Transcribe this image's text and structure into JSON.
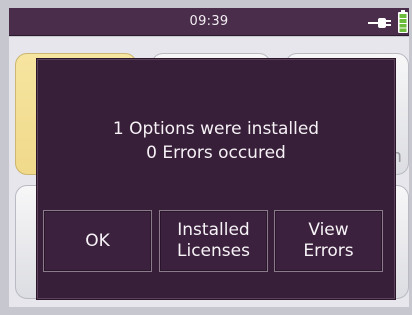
{
  "status_bar": {
    "time": "09:39",
    "icons": [
      "plug-icon",
      "battery-icon"
    ]
  },
  "background": {
    "tile_fragment": "n"
  },
  "dialog": {
    "line1": "1 Options were installed",
    "line2": "0 Errors occured",
    "buttons": {
      "ok": "OK",
      "installed_line1": "Installed",
      "installed_line2": "Licenses",
      "view_line1": "View",
      "view_line2": "Errors"
    }
  },
  "colors": {
    "status_bar": "#4a2c4b",
    "dialog_bg": "#381f39",
    "tile_yellow": "#f0d98a",
    "text": "#f5f1f5",
    "battery_green": "#6dbb3a"
  }
}
